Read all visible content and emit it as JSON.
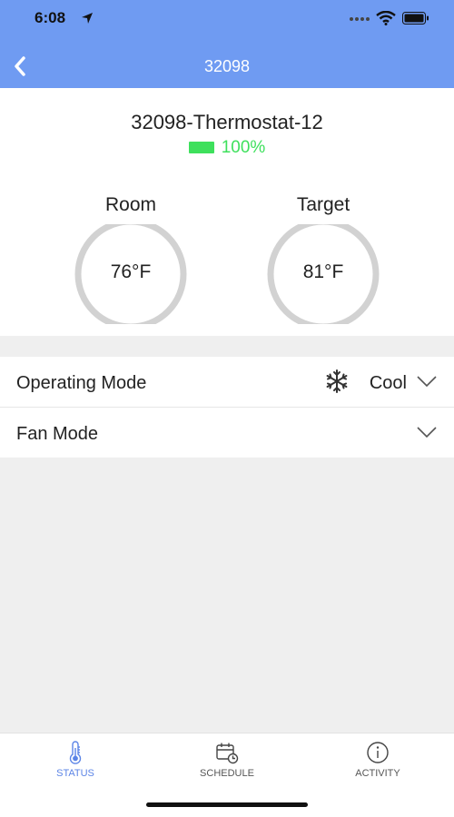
{
  "status_bar": {
    "time": "6:08",
    "icons": [
      "location-arrow-icon",
      "signal-icon",
      "wifi-icon",
      "battery-icon"
    ]
  },
  "nav": {
    "title": "32098",
    "back_icon": "chevron-left-icon"
  },
  "device": {
    "name": "32098-Thermostat-12",
    "battery_percent": "100%",
    "battery_icon": "battery-icon",
    "battery_color": "#3ee05c"
  },
  "gauges": {
    "room": {
      "label": "Room",
      "value": "76°F",
      "fill_fraction": 0.35,
      "color": "#7b4f7e"
    },
    "target": {
      "label": "Target",
      "value": "81°F",
      "fill_fraction": 0.42,
      "color": "#a0334f"
    }
  },
  "settings": {
    "operating_mode": {
      "label": "Operating Mode",
      "value": "Cool",
      "icon": "snowflake-icon"
    },
    "fan_mode": {
      "label": "Fan Mode",
      "value": ""
    }
  },
  "tabs": [
    {
      "label": "STATUS",
      "icon": "thermometer-icon",
      "active": true
    },
    {
      "label": "SCHEDULE",
      "icon": "calendar-clock-icon",
      "active": false
    },
    {
      "label": "ACTIVITY",
      "icon": "info-icon",
      "active": false
    }
  ],
  "colors": {
    "header": "#6f9bf2",
    "accent": "#5b84e6",
    "gauge_track": "#d2d2d2",
    "background": "#efefef"
  }
}
